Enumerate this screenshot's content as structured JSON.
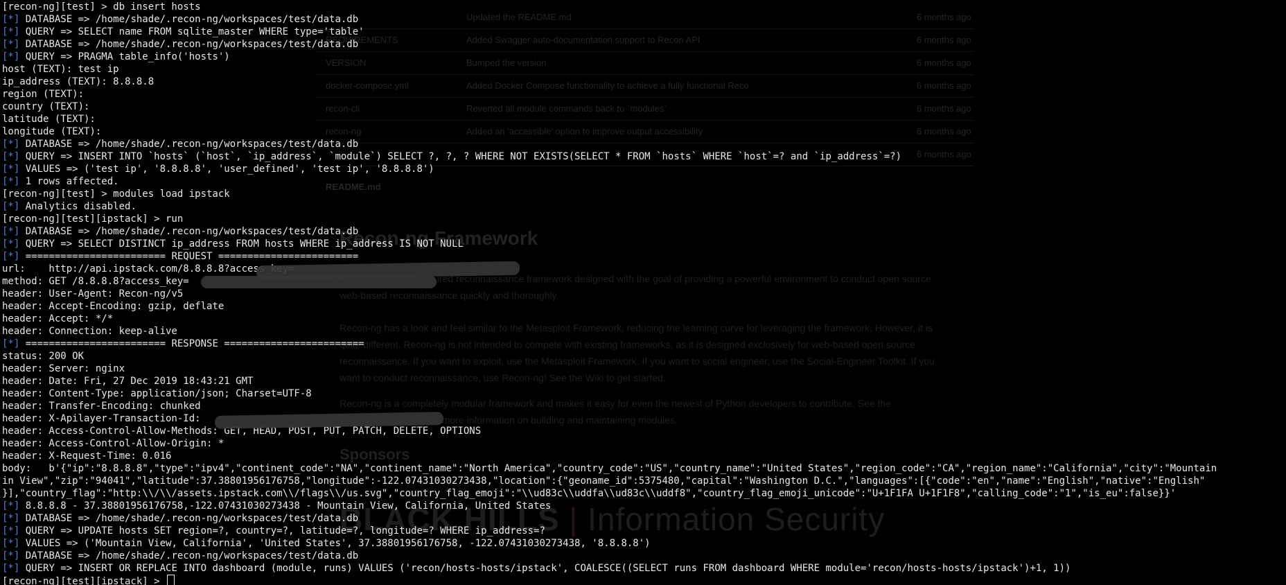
{
  "background_page": {
    "files": [
      {
        "name": "",
        "message": "Updated the README.md",
        "age": "6 months ago"
      },
      {
        "name": "REQUIREMENTS",
        "message": "Added Swagger auto-documentation support to Recon API",
        "age": "6 months ago"
      },
      {
        "name": "VERSION",
        "message": "Bumped the version",
        "age": "6 months ago"
      },
      {
        "name": "docker-compose.yml",
        "message": "Added Docker Compose functionality to achieve a fully functional Reco",
        "age": "6 months ago"
      },
      {
        "name": "recon-cli",
        "message": "Reverted all module commands back to `modules`",
        "age": "6 months ago"
      },
      {
        "name": "recon-ng",
        "message": "Added an 'accessible' option to improve output accessibility",
        "age": "6 months ago"
      },
      {
        "name": "",
        "message": "",
        "age": "6 months ago"
      }
    ],
    "readme_label": "README.md",
    "heading": "Recon-ng Framework",
    "paragraphs": [
      "Recon-ng is a full-featured reconnaissance framework designed with the goal of providing a powerful environment to conduct open source web-based reconnaissance quickly and thoroughly.",
      "Recon-ng has a look and feel similar to the Metasploit Framework, reducing the learning curve for leveraging the framework. However, it is quite different. Recon-ng is not intended to compete with existing frameworks, as it is designed exclusively for web-based open source reconnaissance. If you want to exploit, use the Metasploit Framework. If you want to social engineer, use the Social-Engineer Toolkit. If you want to conduct reconnaissance, use Recon-ng! See the Wiki to get started.",
      "Recon-ng is a completely modular framework and makes it easy for even the newest of Python developers to contribute. See the Development Guide for more information on building and maintaining modules."
    ],
    "sponsors_heading": "Sponsors",
    "sponsor_logo": {
      "strong": "BLACK HILLS",
      "divider": "|",
      "rest": "Information Security"
    }
  },
  "terminal": {
    "tag": "[*]",
    "lines": [
      {
        "tag": false,
        "text": "[recon-ng][test] > db insert hosts"
      },
      {
        "tag": true,
        "text": " DATABASE => /home/shade/.recon-ng/workspaces/test/data.db"
      },
      {
        "tag": true,
        "text": " QUERY => SELECT name FROM sqlite_master WHERE type='table'"
      },
      {
        "tag": true,
        "text": " DATABASE => /home/shade/.recon-ng/workspaces/test/data.db"
      },
      {
        "tag": true,
        "text": " QUERY => PRAGMA table_info('hosts')"
      },
      {
        "tag": false,
        "text": "host (TEXT): test ip"
      },
      {
        "tag": false,
        "text": "ip_address (TEXT): 8.8.8.8"
      },
      {
        "tag": false,
        "text": "region (TEXT):"
      },
      {
        "tag": false,
        "text": "country (TEXT):"
      },
      {
        "tag": false,
        "text": "latitude (TEXT):"
      },
      {
        "tag": false,
        "text": "longitude (TEXT):"
      },
      {
        "tag": true,
        "text": " DATABASE => /home/shade/.recon-ng/workspaces/test/data.db"
      },
      {
        "tag": true,
        "text": " QUERY => INSERT INTO `hosts` (`host`, `ip_address`, `module`) SELECT ?, ?, ? WHERE NOT EXISTS(SELECT * FROM `hosts` WHERE `host`=? and `ip_address`=?)"
      },
      {
        "tag": true,
        "text": " VALUES => ('test ip', '8.8.8.8', 'user_defined', 'test ip', '8.8.8.8')"
      },
      {
        "tag": true,
        "text": " 1 rows affected."
      },
      {
        "tag": false,
        "text": "[recon-ng][test] > modules load ipstack"
      },
      {
        "tag": true,
        "text": " Analytics disabled."
      },
      {
        "tag": false,
        "text": "[recon-ng][test][ipstack] > run"
      },
      {
        "tag": true,
        "text": " DATABASE => /home/shade/.recon-ng/workspaces/test/data.db"
      },
      {
        "tag": true,
        "text": " QUERY => SELECT DISTINCT ip_address FROM hosts WHERE ip_address IS NOT NULL"
      },
      {
        "tag": true,
        "text": " ======================== REQUEST ========================"
      },
      {
        "tag": false,
        "text": "url:    http://api.ipstack.com/8.8.8.8?access_key="
      },
      {
        "tag": false,
        "text": "method: GET /8.8.8.8?access_key="
      },
      {
        "tag": false,
        "text": "header: User-Agent: Recon-ng/v5"
      },
      {
        "tag": false,
        "text": "header: Accept-Encoding: gzip, deflate"
      },
      {
        "tag": false,
        "text": "header: Accept: */*"
      },
      {
        "tag": false,
        "text": "header: Connection: keep-alive"
      },
      {
        "tag": true,
        "text": " ======================== RESPONSE ========================"
      },
      {
        "tag": false,
        "text": "status: 200 OK"
      },
      {
        "tag": false,
        "text": "header: Server: nginx"
      },
      {
        "tag": false,
        "text": "header: Date: Fri, 27 Dec 2019 18:43:21 GMT"
      },
      {
        "tag": false,
        "text": "header: Content-Type: application/json; Charset=UTF-8"
      },
      {
        "tag": false,
        "text": "header: Transfer-Encoding: chunked"
      },
      {
        "tag": false,
        "text": "header: X-Apilayer-Transaction-Id:"
      },
      {
        "tag": false,
        "text": "header: Access-Control-Allow-Methods: GET, HEAD, POST, PUT, PATCH, DELETE, OPTIONS"
      },
      {
        "tag": false,
        "text": "header: Access-Control-Allow-Origin: *"
      },
      {
        "tag": false,
        "text": "header: X-Request-Time: 0.016"
      },
      {
        "tag": false,
        "text": "body:   b'{\"ip\":\"8.8.8.8\",\"type\":\"ipv4\",\"continent_code\":\"NA\",\"continent_name\":\"North America\",\"country_code\":\"US\",\"country_name\":\"United States\",\"region_code\":\"CA\",\"region_name\":\"California\",\"city\":\"Mountain"
      },
      {
        "tag": false,
        "text": "in View\",\"zip\":\"94041\",\"latitude\":37.38801956176758,\"longitude\":-122.07431030273438,\"location\":{\"geoname_id\":5375480,\"capital\":\"Washington D.C.\",\"languages\":[{\"code\":\"en\",\"name\":\"English\",\"native\":\"English\""
      },
      {
        "tag": false,
        "text": "}],\"country_flag\":\"http:\\\\/\\\\/assets.ipstack.com\\\\/flags\\\\/us.svg\",\"country_flag_emoji\":\"\\\\ud83c\\\\uddfa\\\\ud83c\\\\uddf8\",\"country_flag_emoji_unicode\":\"U+1F1FA U+1F1F8\",\"calling_code\":\"1\",\"is_eu\":false}}'"
      },
      {
        "tag": true,
        "text": " 8.8.8.8 - 37.38801956176758,-122.07431030273438 - Mountain View, California, United States"
      },
      {
        "tag": true,
        "text": " DATABASE => /home/shade/.recon-ng/workspaces/test/data.db"
      },
      {
        "tag": true,
        "text": " QUERY => UPDATE hosts SET region=?, country=?, latitude=?, longitude=? WHERE ip_address=?"
      },
      {
        "tag": true,
        "text": " VALUES => ('Mountain View, California', 'United States', 37.38801956176758, -122.07431030273438, '8.8.8.8')"
      },
      {
        "tag": true,
        "text": " DATABASE => /home/shade/.recon-ng/workspaces/test/data.db"
      },
      {
        "tag": true,
        "text": " QUERY => INSERT OR REPLACE INTO dashboard (module, runs) VALUES ('recon/hosts-hosts/ipstack', COALESCE((SELECT runs FROM dashboard WHERE module='recon/hosts-hosts/ipstack')+1, 1))"
      },
      {
        "tag": false,
        "text": "[recon-ng][test][ipstack] > "
      }
    ]
  },
  "colors": {
    "background": "#000000",
    "text": "#e8e8e8",
    "tag": "#4f7fd8"
  }
}
